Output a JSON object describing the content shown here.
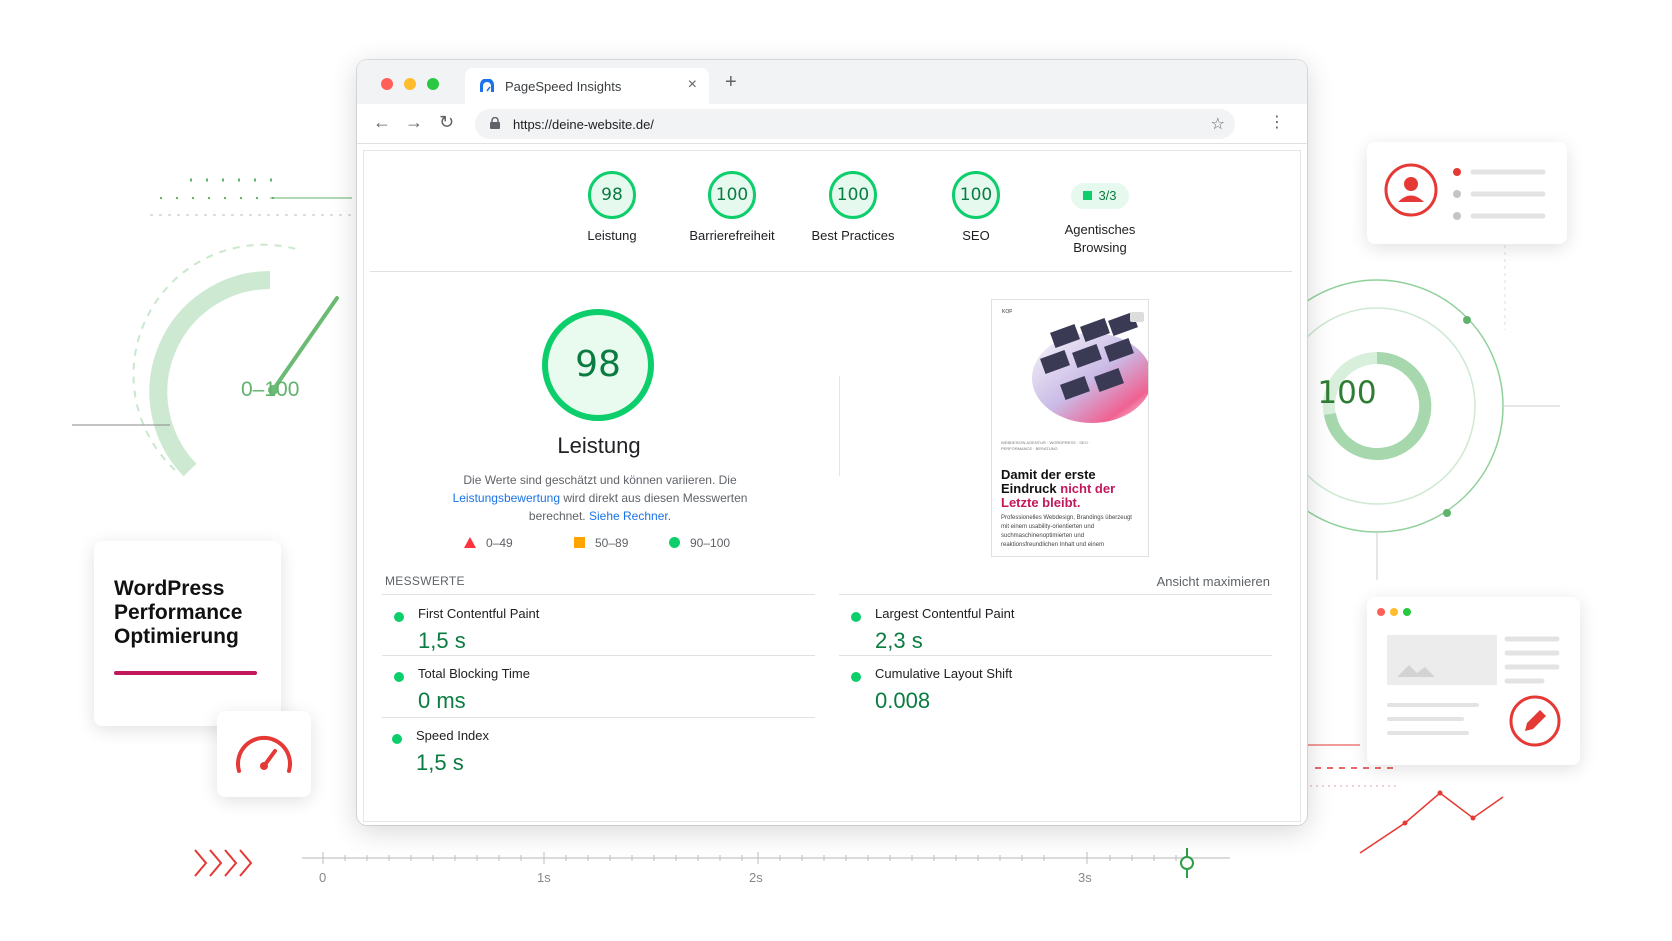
{
  "browser": {
    "tab_title": "PageSpeed Insights",
    "tab_close": "×",
    "new_tab": "+",
    "url": "https://deine-website.de/",
    "nav": {
      "back": "←",
      "forward": "→",
      "reload": "↻",
      "bookmark": "☆",
      "menu": "⋮"
    }
  },
  "scores": [
    {
      "value": "98",
      "label": "Leistung"
    },
    {
      "value": "100",
      "label": "Barrierefreiheit"
    },
    {
      "value": "100",
      "label": "Best Practices"
    },
    {
      "value": "100",
      "label": "SEO"
    }
  ],
  "agentic": {
    "badge": "3/3",
    "label": "Agentisches Browsing"
  },
  "performance": {
    "score": "98",
    "title": "Leistung",
    "desc_1": "Die Werte sind geschätzt und können variieren. Die",
    "desc_link_1": "Leistungsbewertung",
    "desc_2": "wird direkt aus diesen Messwerten berechnet.",
    "desc_link_2": "Siehe Rechner",
    "desc_end": "."
  },
  "legend": {
    "fail": "0–49",
    "average": "50–89",
    "pass": "90–100"
  },
  "metrics_header": "MESSWERTE",
  "expand": "Ansicht maximieren",
  "metrics": [
    {
      "name": "First Contentful Paint",
      "value": "1,5 s"
    },
    {
      "name": "Largest Contentful Paint",
      "value": "2,3 s"
    },
    {
      "name": "Total Blocking Time",
      "value": "0 ms"
    },
    {
      "name": "Cumulative Layout Shift",
      "value": "0.008"
    },
    {
      "name": "Speed Index",
      "value": "1,5 s"
    }
  ],
  "thumbnail": {
    "logo": "KOPF UND STIFT",
    "small": "WEBDESIGN AGENTUR · WORDPRESS · SEO · PERFORMANCE · BERATUNG",
    "head_1": "Damit der erste Eindruck",
    "head_red": "nicht der Letzte bleibt.",
    "body": "Professionelles Webdesign, Brandings überzeugt mit einem usability-orientierten und suchmaschinenoptimierten und reaktionsfreundlichen Inhalt und einem"
  },
  "decor": {
    "gauge_range": "0–100",
    "big_score": "100",
    "wp_card": "WordPress Performance Optimierung",
    "timeline": [
      "0",
      "1s",
      "2s",
      "3s"
    ]
  },
  "colors": {
    "pass": "#0cce6b",
    "pass_text": "#0a7c41",
    "average": "#ffa400",
    "fail": "#ff333d",
    "brand": "#c2185b",
    "link": "#1a73e8"
  },
  "icons": [
    "pagespeed-icon",
    "lock-icon",
    "star-icon",
    "more-icon",
    "user-icon",
    "speedometer-icon",
    "pencil-icon",
    "chevrons-icon"
  ]
}
